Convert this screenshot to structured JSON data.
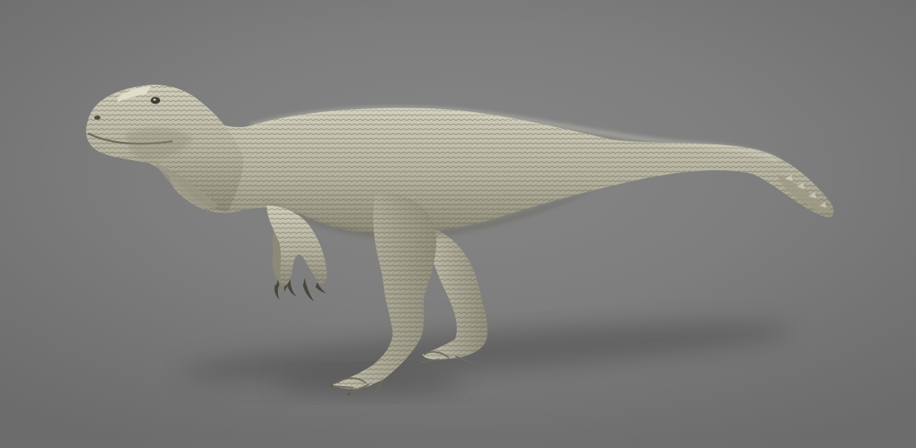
{
  "scene": {
    "subject": "dinosaur-model",
    "colors": {
      "background_center": "#868686",
      "background_edge": "#6c6c6c",
      "skin_light": "#d4d2bf",
      "skin_mid": "#aeac98",
      "skin_dark": "#6f6d5e",
      "shadow": "#4f4f4f"
    }
  }
}
